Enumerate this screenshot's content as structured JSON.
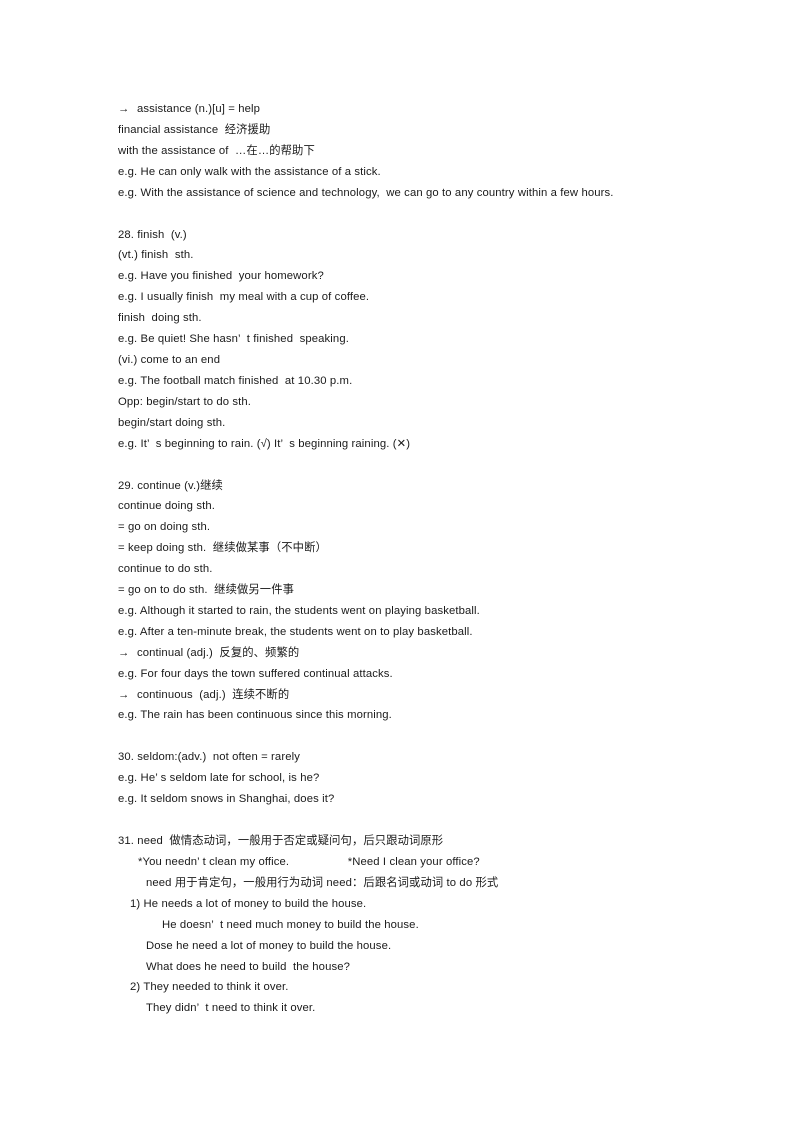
{
  "document": {
    "page_background": "#ffffff",
    "text_color": "#1a1a1a",
    "icons": {
      "arrow": "right-arrow-icon",
      "check": "check-mark",
      "cross": "cross-mark"
    }
  },
  "blocks": [
    {
      "id": "assistance",
      "lines": [
        {
          "arrow": true,
          "indent": 0,
          "text": "assistance (n.)[u] = help"
        },
        {
          "arrow": false,
          "indent": 0,
          "text": "financial assistance  经济援助"
        },
        {
          "arrow": false,
          "indent": 0,
          "text": "with the assistance of  …在…的帮助下"
        },
        {
          "arrow": false,
          "indent": 0,
          "text": "e.g. He can only walk with the assistance of a stick."
        },
        {
          "arrow": false,
          "indent": 0,
          "text": "e.g. With the assistance of science and technology,  we can go to any country within a few hours."
        }
      ]
    },
    {
      "id": "finish",
      "lines": [
        {
          "arrow": false,
          "indent": 0,
          "text": "28. finish  (v.)"
        },
        {
          "arrow": false,
          "indent": 0,
          "text": "(vt.) finish  sth."
        },
        {
          "arrow": false,
          "indent": 0,
          "text": "e.g. Have you finished  your homework?"
        },
        {
          "arrow": false,
          "indent": 0,
          "text": "e.g. I usually finish  my meal with a cup of coffee."
        },
        {
          "arrow": false,
          "indent": 0,
          "text": "finish  doing sth."
        },
        {
          "arrow": false,
          "indent": 0,
          "text": "e.g. Be quiet! She hasn’  t finished  speaking."
        },
        {
          "arrow": false,
          "indent": 0,
          "text": "(vi.) come to an end"
        },
        {
          "arrow": false,
          "indent": 0,
          "text": "e.g. The football match finished  at 10.30 p.m."
        },
        {
          "arrow": false,
          "indent": 0,
          "text": "Opp: begin/start to do sth."
        },
        {
          "arrow": false,
          "indent": 0,
          "text": "begin/start doing sth."
        },
        {
          "arrow": false,
          "indent": 0,
          "text": "e.g. It’  s beginning to rain. (√) It’  s beginning raining. (✕)"
        }
      ]
    },
    {
      "id": "continue",
      "lines": [
        {
          "arrow": false,
          "indent": 0,
          "text": "29. continue (v.)继续"
        },
        {
          "arrow": false,
          "indent": 0,
          "text": "continue doing sth."
        },
        {
          "arrow": false,
          "indent": 0,
          "text": "= go on doing sth."
        },
        {
          "arrow": false,
          "indent": 0,
          "text": "= keep doing sth.  继续做某事（不中断）"
        },
        {
          "arrow": false,
          "indent": 0,
          "text": "continue to do sth."
        },
        {
          "arrow": false,
          "indent": 0,
          "text": "= go on to do sth.  继续做另一件事"
        },
        {
          "arrow": false,
          "indent": 0,
          "text": "e.g. Although it started to rain, the students went on playing basketball."
        },
        {
          "arrow": false,
          "indent": 0,
          "text": "e.g. After a ten-minute break, the students went on to play basketball."
        },
        {
          "arrow": true,
          "indent": 0,
          "text": "continual (adj.)  反复的、频繁的"
        },
        {
          "arrow": false,
          "indent": 0,
          "text": "e.g. For four days the town suffered continual attacks."
        },
        {
          "arrow": true,
          "indent": 0,
          "text": "continuous  (adj.)  连续不断的"
        },
        {
          "arrow": false,
          "indent": 0,
          "text": "e.g. The rain has been continuous since this morning."
        }
      ]
    },
    {
      "id": "seldom",
      "lines": [
        {
          "arrow": false,
          "indent": 0,
          "text": "30. seldom:(adv.)  not often = rarely"
        },
        {
          "arrow": false,
          "indent": 0,
          "text": "e.g. He’ s seldom late for school, is he?"
        },
        {
          "arrow": false,
          "indent": 0,
          "text": "e.g. It seldom snows in Shanghai, does it?"
        }
      ]
    },
    {
      "id": "need",
      "lines": [
        {
          "arrow": false,
          "indent": 0,
          "text": "31. need  做情态动词，一般用于否定或疑问句，后只跟动词原形"
        },
        {
          "arrow": false,
          "indent": 2,
          "text": "*You needn’ t clean my office.                  *Need I clean your office?"
        },
        {
          "arrow": false,
          "indent": 3,
          "text": "need 用于肯定句，一般用行为动词 need：后跟名词或动词 to do 形式"
        },
        {
          "arrow": false,
          "indent": 1,
          "text": "1) He needs a lot of money to build the house."
        },
        {
          "arrow": false,
          "indent": 4,
          "text": "He doesn’  t need much money to build the house."
        },
        {
          "arrow": false,
          "indent": 3,
          "text": "Dose he need a lot of money to build the house."
        },
        {
          "arrow": false,
          "indent": 3,
          "text": "What does he need to build  the house?"
        },
        {
          "arrow": false,
          "indent": 1,
          "text": "2) They needed to think it over."
        },
        {
          "arrow": false,
          "indent": 3,
          "text": "They didn’  t need to think it over."
        }
      ]
    }
  ]
}
